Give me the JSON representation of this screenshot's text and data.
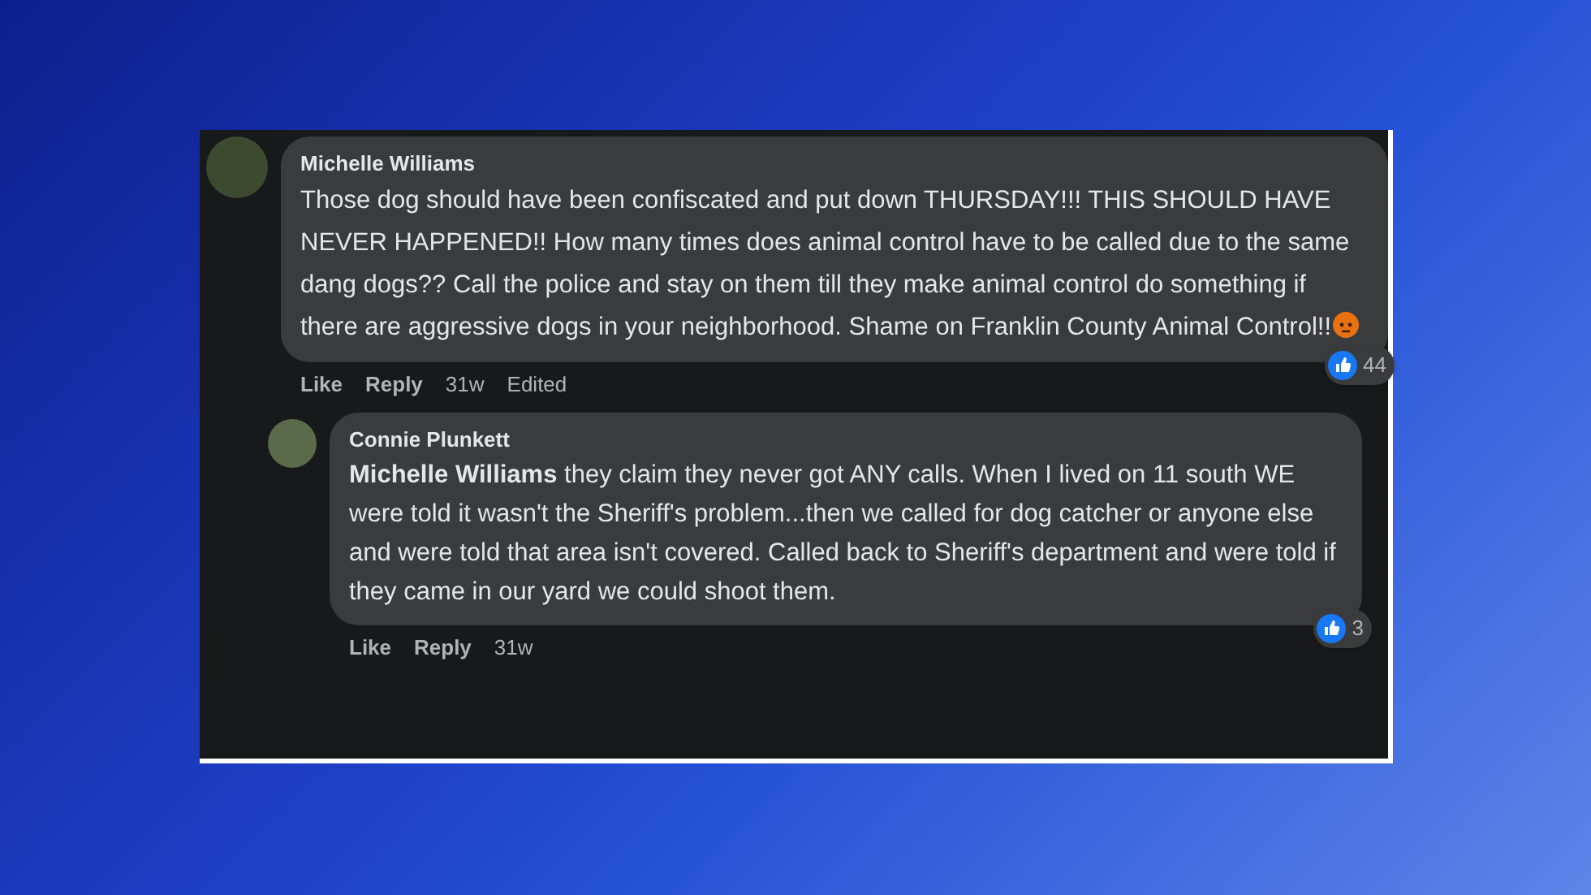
{
  "comment": {
    "author": "Michelle Williams",
    "text": "Those dog should have been confiscated and put down THURSDAY!!! THIS SHOULD HAVE NEVER HAPPENED!! How many times does animal control have to be called due to the same dang dogs?? Call the police and stay on them till they make animal control do something if there are aggressive dogs in your neighborhood. Shame on Franklin County Animal Control!!",
    "angry_emoji": true,
    "actions": [
      "Like",
      "Reply"
    ],
    "time": "31w",
    "edited": "Edited",
    "reaction_count": "44",
    "replies": [
      {
        "author": "Connie Plunkett",
        "text": "**Michelle Williams** they claim they never got ANY calls. When I lived on 11 south WE were told it wasn't the Sheriff's problem...then we called for dog catcher or anyone else and were told that area isn't covered. Called back to Sheriff's department and were told if they came in our yard we could shoot them.",
        "actions": [
          "Like",
          "Reply"
        ],
        "time": "31w",
        "reaction_count": "3"
      }
    ]
  }
}
